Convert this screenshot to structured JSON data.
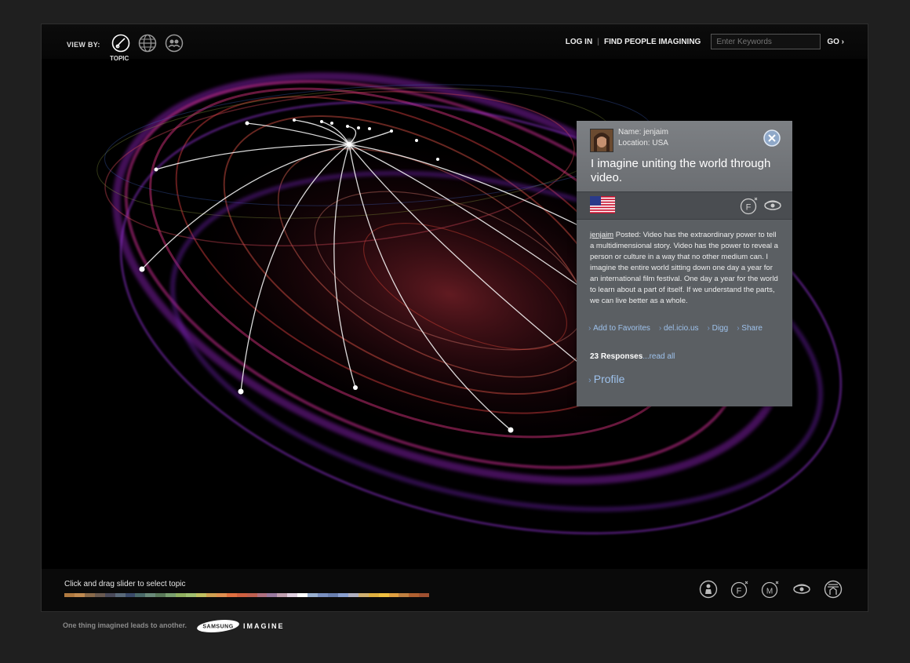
{
  "header": {
    "view_by_label": "VIEW BY:",
    "view_icons": [
      "topic-icon",
      "globe-icon",
      "people-icon"
    ],
    "topic_label": "TOPIC",
    "login": "LOG IN",
    "find_people": "FIND PEOPLE IMAGINING",
    "search_placeholder": "Enter Keywords",
    "go": "GO ›"
  },
  "card": {
    "name": "Name: jenjaim",
    "location": "Location: USA",
    "headline": "I imagine uniting the world through video.",
    "post_user": "jenjaim",
    "post_text": " Posted: Video has the extraordinary power to tell a multidimensional story. Video has the power to reveal a person or culture in a way that no other medium can. I imagine the entire world sitting down one day a year for an international film festival. One day a year for the world to learn about a part of itself. If we understand the parts, we can live better as a whole.",
    "actions": [
      "Add to Favorites",
      "del.icio.us",
      "Digg",
      "Share"
    ],
    "responses_count": "23 Responses",
    "read_all": "...read all",
    "profile": "Profile",
    "flag": "usa-flag",
    "strip_icons": [
      "f-icon",
      "eye-icon"
    ]
  },
  "bottom": {
    "slider_label": "Click and drag slider to select topic",
    "category_icons": [
      "person-icon",
      "f-icon",
      "m-icon",
      "eye-icon",
      "home-icon"
    ]
  },
  "footer": {
    "tagline": "One thing imagined leads to another.",
    "brand": "SAMSUNG",
    "imagine": "IMAGINE"
  },
  "colors": {
    "background": "#1f1f1f",
    "card": "#5b5f63",
    "link": "#9ec2ec"
  }
}
